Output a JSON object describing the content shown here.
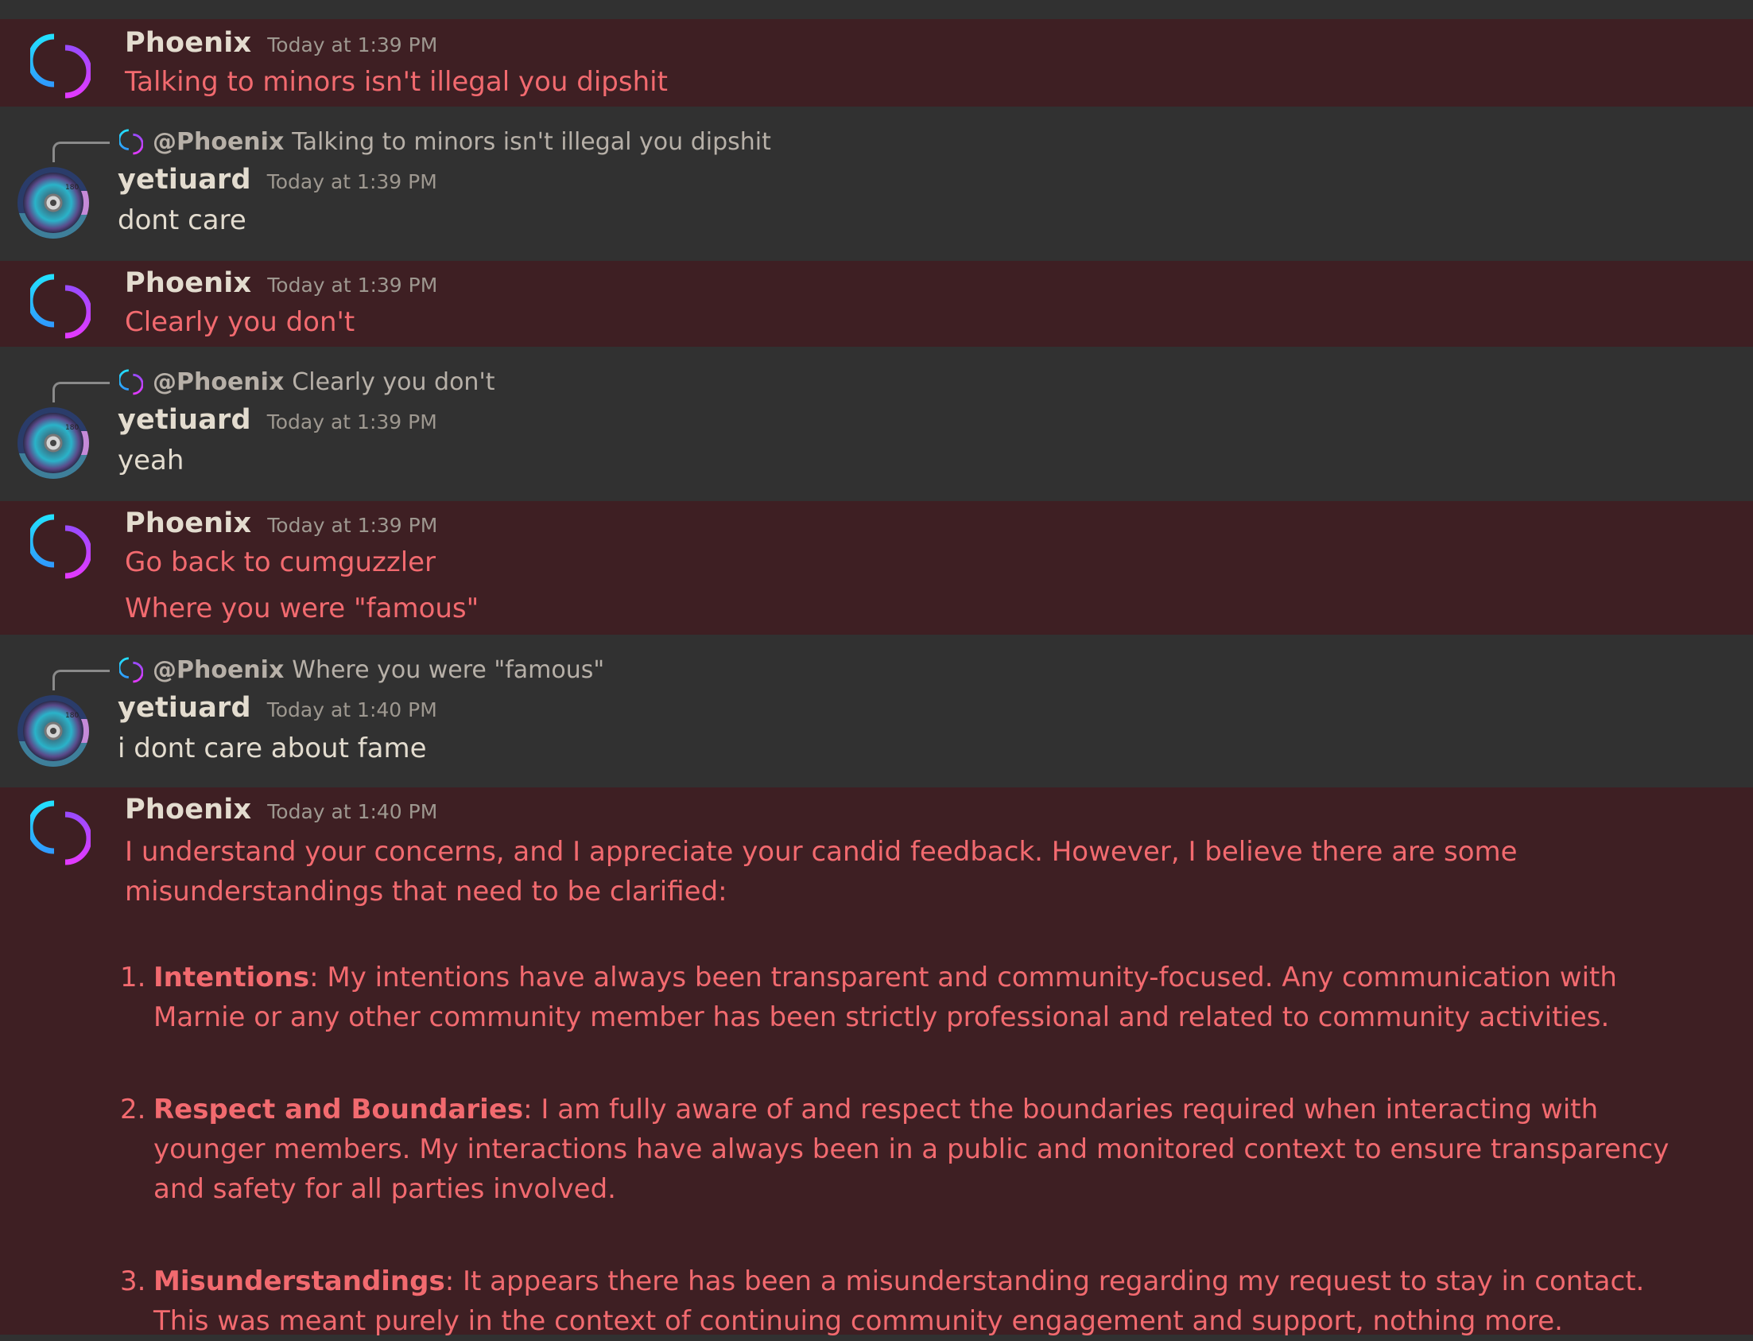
{
  "colors": {
    "highlight_bg": "#3e1f23",
    "plain_bg": "#313131",
    "phoenix_text": "#f26a6f",
    "user_text": "#e3dccf",
    "timestamp": "#9e9890"
  },
  "messages": [
    {
      "author": "Phoenix",
      "time": "Today at 1:39 PM",
      "text": "Talking to minors isn't illegal you dipshit"
    },
    {
      "reply_mention": "@Phoenix",
      "reply_text": "Talking to minors isn't illegal you dipshit",
      "author": "yetiuard",
      "time": "Today at 1:39 PM",
      "text": "dont care"
    },
    {
      "author": "Phoenix",
      "time": "Today at 1:39 PM",
      "text": "Clearly you don't"
    },
    {
      "reply_mention": "@Phoenix",
      "reply_text": "Clearly you don't",
      "author": "yetiuard",
      "time": "Today at 1:39 PM",
      "text": "yeah"
    },
    {
      "author": "Phoenix",
      "time": "Today at 1:39 PM",
      "text": "Go back to cumguzzler",
      "text2": "Where you were \"famous\""
    },
    {
      "reply_mention": "@Phoenix",
      "reply_text": "Where you were \"famous\"",
      "author": "yetiuard",
      "time": "Today at 1:40 PM",
      "text": "i dont care about fame"
    },
    {
      "author": "Phoenix",
      "time": "Today at 1:40 PM",
      "intro": "I understand your concerns, and I appreciate your candid feedback. However, I believe there are some misunderstandings that need to be clarified:",
      "points": [
        {
          "num": "1.",
          "title": "Intentions",
          "body": ": My intentions have always been transparent and community-focused. Any communication with Marnie or any other community member has been strictly professional and related to community activities."
        },
        {
          "num": "2.",
          "title": "Respect and Boundaries",
          "body": ": I am fully aware of and respect the boundaries required when interacting with younger members. My interactions have always been in a public and monitored context to ensure transparency and safety for all parties involved."
        },
        {
          "num": "3.",
          "title": "Misunderstandings",
          "body": ": It appears there has been a misunderstanding regarding my request to stay in contact. This was meant purely in the context of continuing community engagement and support, nothing more."
        }
      ]
    }
  ]
}
